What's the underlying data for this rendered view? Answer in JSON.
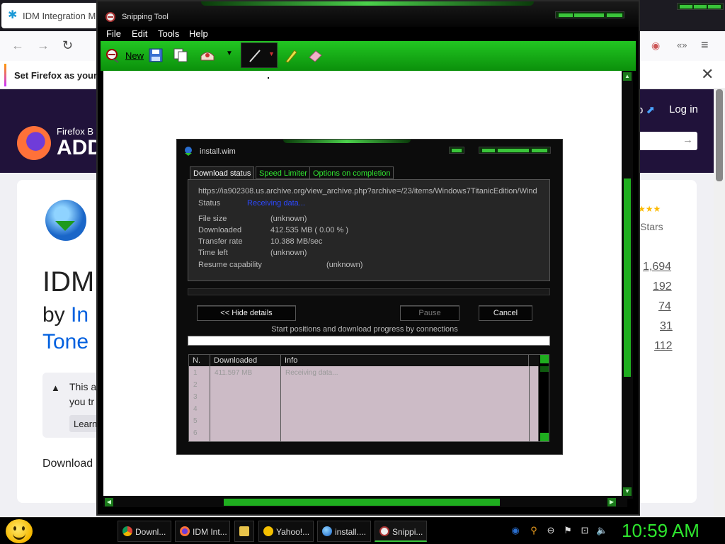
{
  "firefox": {
    "tab_title": "IDM Integration Mo",
    "notice_text": "Set Firefox as your d",
    "header": {
      "brand_small": "Firefox B",
      "brand_large": "ADD",
      "login": "Log in",
      "link_partial": "o"
    },
    "card": {
      "title": "IDM",
      "by_prefix": "by ",
      "by_author": "In",
      "author_line2": "Tone",
      "warning_line1": "This a",
      "warning_line2": "you tr",
      "learn_button": "Learn",
      "download_text": "Download"
    },
    "stats_label": "Stars",
    "ratings": [
      "1,694",
      "192",
      "74",
      "31",
      "112"
    ]
  },
  "snipping_tool": {
    "title": "Snipping Tool",
    "menu": [
      "File",
      "Edit",
      "Tools",
      "Help"
    ],
    "toolbar": {
      "new_label": "New"
    }
  },
  "idm_dialog": {
    "title": "install.wim",
    "tabs": [
      "Download status",
      "Speed Limiter",
      "Options on completion"
    ],
    "url": "https://ia902308.us.archive.org/view_archive.php?archive=/23/items/Windows7TitanicEdition/Wind",
    "status_label": "Status",
    "status_value": "Receiving data...",
    "file_size_label": "File size",
    "file_size_value": "(unknown)",
    "downloaded_label": "Downloaded",
    "downloaded_value": "412.535  MB  ( 0.00 % )",
    "transfer_rate_label": "Transfer rate",
    "transfer_rate_value": "10.388  MB/sec",
    "time_left_label": "Time left",
    "time_left_value": "(unknown)",
    "resume_label": "Resume capability",
    "resume_value": "(unknown)",
    "buttons": {
      "hide_details": "<< Hide details",
      "pause": "Pause",
      "cancel": "Cancel"
    },
    "connections_label": "Start positions and download progress by connections",
    "table": {
      "headers": [
        "N.",
        "Downloaded",
        "Info"
      ],
      "rows": [
        {
          "n": "1",
          "downloaded": "411.597 MB",
          "info": "Receiving data..."
        },
        {
          "n": "2",
          "downloaded": "",
          "info": ""
        },
        {
          "n": "3",
          "downloaded": "",
          "info": ""
        },
        {
          "n": "4",
          "downloaded": "",
          "info": ""
        },
        {
          "n": "5",
          "downloaded": "",
          "info": ""
        },
        {
          "n": "6",
          "downloaded": "",
          "info": ""
        }
      ]
    }
  },
  "taskbar": {
    "items": [
      {
        "label": "Downl...",
        "icon": "chrome-icon"
      },
      {
        "label": "IDM Int...",
        "icon": "firefox-icon"
      },
      {
        "label": "",
        "icon": "folder-icon"
      },
      {
        "label": "Yahoo!...",
        "icon": "yahoo-messenger-icon"
      },
      {
        "label": "install....",
        "icon": "idm-icon"
      },
      {
        "label": "Snippi...",
        "icon": "snipping-tool-icon"
      }
    ],
    "clock": "10:59 AM"
  },
  "colors": {
    "accent_green": "#2ee62e",
    "toolbar_green": "#12a812",
    "status_blue": "#2c48ff"
  }
}
